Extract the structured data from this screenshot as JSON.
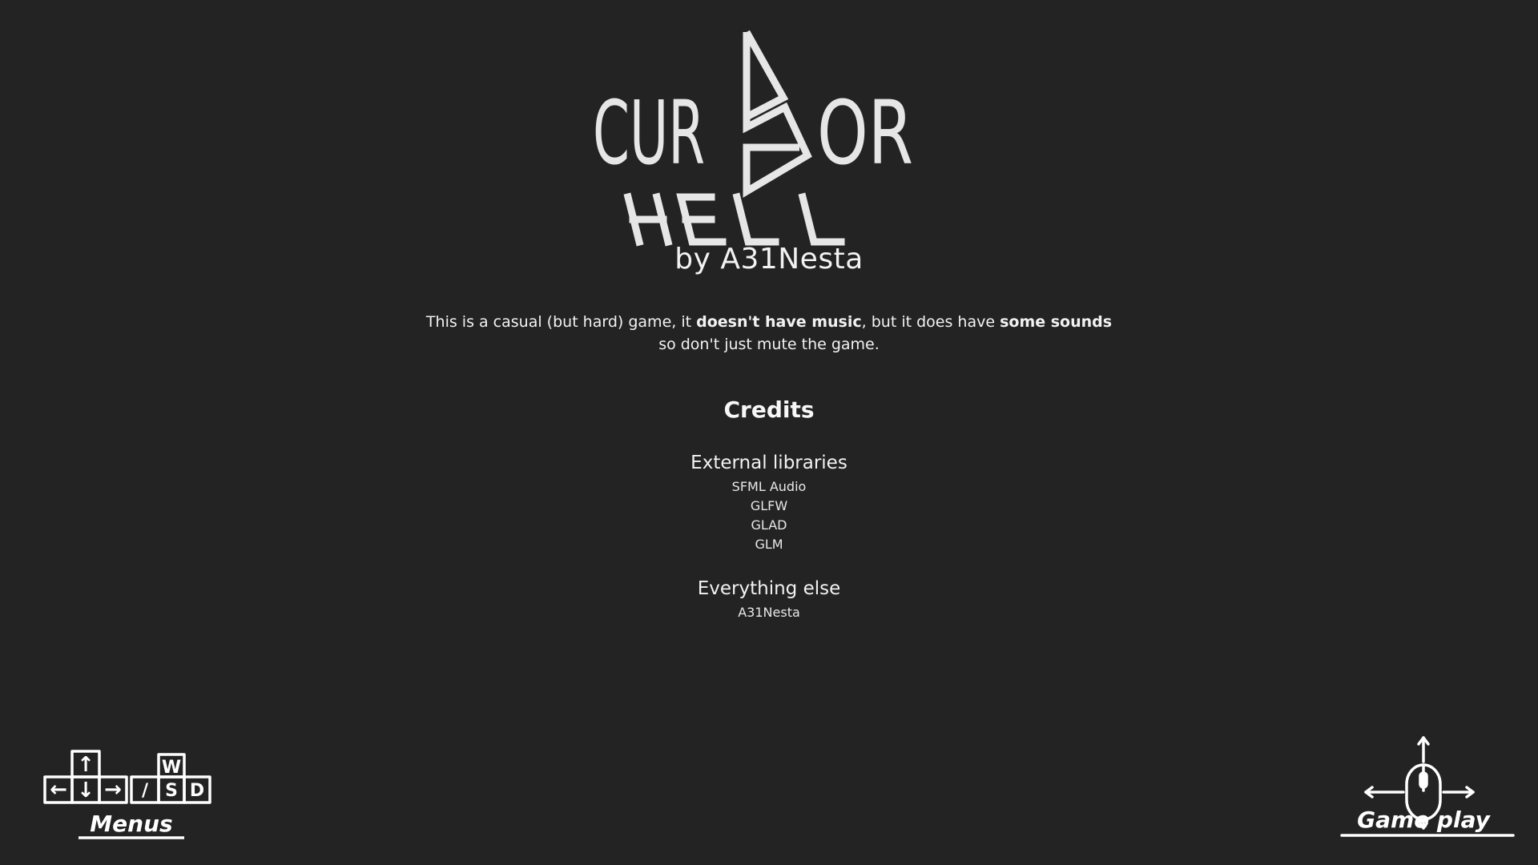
{
  "logo": {
    "line1": "CURSOR",
    "line2": "HELL"
  },
  "byline": "by A31Nesta",
  "description": {
    "part1": "This is a casual (but hard) game, it ",
    "bold1": "doesn't have music",
    "part2": ", but it does have ",
    "bold2": "some sounds",
    "part3": " so don't just mute the game."
  },
  "credits": {
    "heading": "Credits",
    "sections": [
      {
        "title": "External libraries",
        "items": [
          "SFML Audio",
          "GLFW",
          "GLAD",
          "GLM"
        ]
      },
      {
        "title": "Everything else",
        "items": [
          "A31Nesta"
        ]
      }
    ]
  },
  "hints": {
    "menus": {
      "label": "Menus",
      "keys": [
        "↑",
        "←",
        "↓",
        "→",
        "W",
        "/",
        "S",
        "D"
      ]
    },
    "gameplay": {
      "label": "Game play"
    }
  },
  "colors": {
    "background": "#232323",
    "text": "#f2f2f2",
    "logo": "#e6e6e6"
  },
  "icons": {
    "logo_cursor": "cursor-arrow-icon",
    "menus": "keyboard-keys-icon",
    "gameplay": "mouse-icon"
  }
}
